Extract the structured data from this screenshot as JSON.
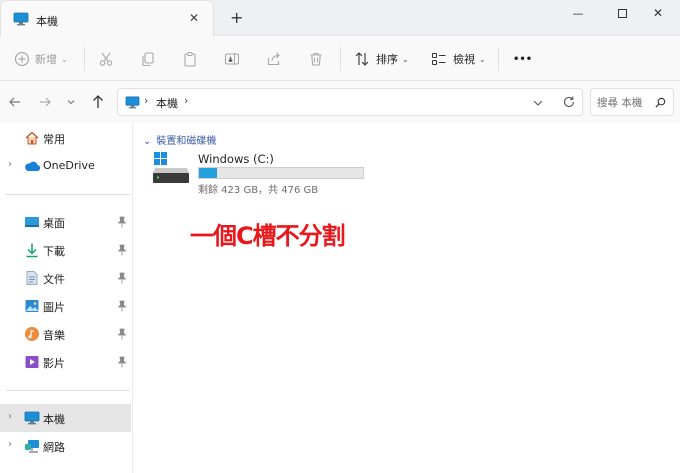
{
  "window": {
    "tab_title": "本機",
    "new_tab": "+",
    "minimize": "—",
    "close": "✕"
  },
  "toolbar": {
    "new_label": "新增",
    "sort_label": "排序",
    "view_label": "檢視",
    "more_label": "•••"
  },
  "address": {
    "crumb": "本機",
    "search_placeholder": "搜尋 本機"
  },
  "sidebar": {
    "home": "常用",
    "onedrive": "OneDrive",
    "quick": [
      {
        "label": "桌面",
        "icon": "desktop-icon"
      },
      {
        "label": "下載",
        "icon": "download-icon"
      },
      {
        "label": "文件",
        "icon": "documents-icon"
      },
      {
        "label": "圖片",
        "icon": "pictures-icon"
      },
      {
        "label": "音樂",
        "icon": "music-icon"
      },
      {
        "label": "影片",
        "icon": "videos-icon"
      }
    ],
    "this_pc": "本機",
    "network": "網路"
  },
  "main": {
    "section_title": "裝置和磁碟機",
    "drive": {
      "name": "Windows (C:)",
      "used_fraction": 0.111,
      "space_text": "剩餘 423 GB，共 476 GB"
    },
    "annotation": "一個C槽不分割"
  },
  "colors": {
    "accent": "#26a0da",
    "annotation": "#e8171b",
    "section": "#3a5da8"
  }
}
